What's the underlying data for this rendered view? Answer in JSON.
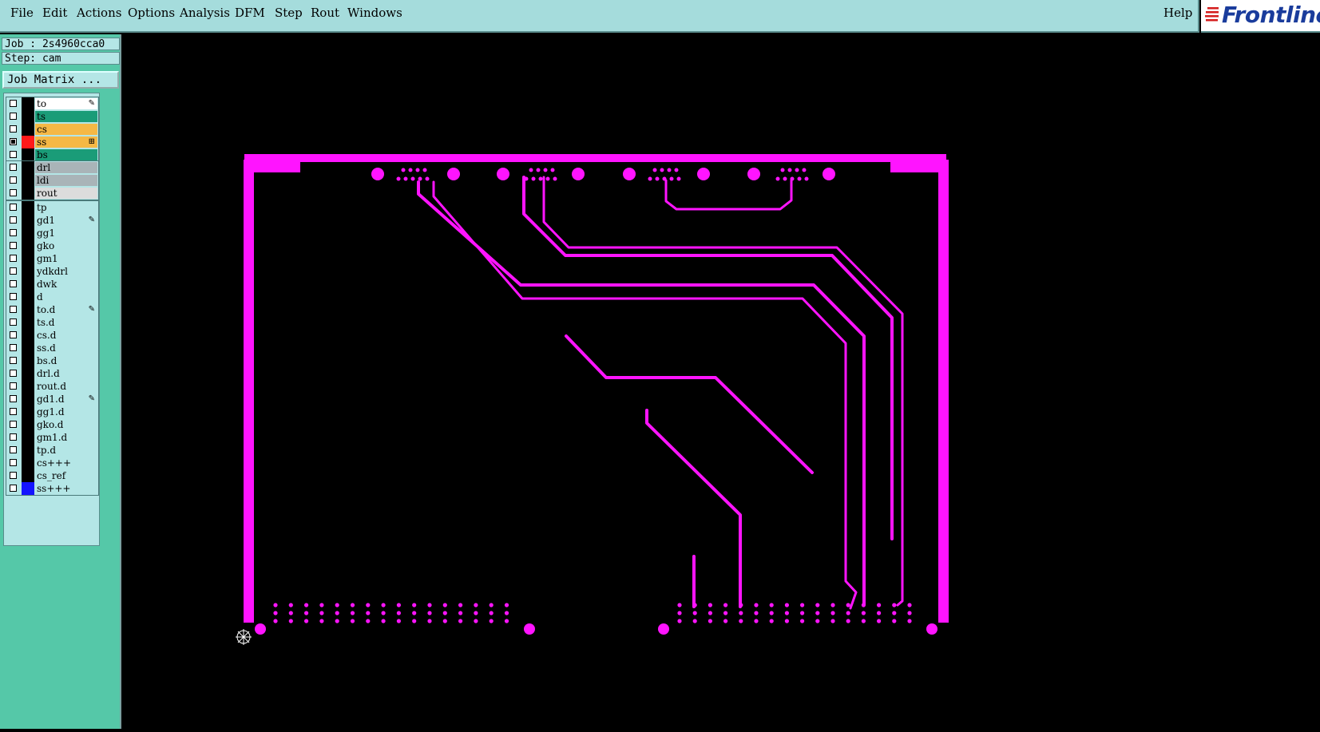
{
  "menubar": {
    "items": [
      "File",
      "Edit",
      "Actions",
      "Options",
      "Analysis",
      "DFM",
      "Step",
      "Rout",
      "Windows"
    ],
    "help": "Help"
  },
  "logo": {
    "text": "Frontline",
    "accent": "#d41c1c",
    "text_color": "#1a3c9c"
  },
  "sidebar": {
    "job_label": "Job : 2s4960cca0",
    "step_label": "Step: cam",
    "job_matrix_button": "Job Matrix ...",
    "layer_groups": [
      [
        {
          "name": "to",
          "color": "#ffffff",
          "checked": false,
          "swatch": "#000000",
          "mark": "pen"
        },
        {
          "name": "ts",
          "color": "#1a9c78",
          "checked": false,
          "swatch": "#000000",
          "mark": ""
        },
        {
          "name": "cs",
          "color": "#f5b845",
          "checked": false,
          "swatch": "#000000",
          "mark": ""
        },
        {
          "name": "ss",
          "color": "#f5b845",
          "checked": true,
          "swatch": "#ff1a1a",
          "mark": "grid"
        },
        {
          "name": "bs",
          "color": "#1a9c78",
          "checked": false,
          "swatch": "#000000",
          "mark": ""
        }
      ],
      [
        {
          "name": "drl",
          "color": "#a9b4b8",
          "checked": false,
          "swatch": "#000000",
          "mark": ""
        },
        {
          "name": "ldi",
          "color": "#a9b4b8",
          "checked": false,
          "swatch": "#000000",
          "mark": ""
        },
        {
          "name": "rout",
          "color": "#dcdcdc",
          "checked": false,
          "swatch": "#000000",
          "mark": ""
        }
      ],
      [
        {
          "name": "tp",
          "color": "#b4e6e6",
          "checked": false,
          "swatch": "#000000",
          "mark": ""
        },
        {
          "name": "gd1",
          "color": "#b4e6e6",
          "checked": false,
          "swatch": "#000000",
          "mark": "pen"
        },
        {
          "name": "gg1",
          "color": "#b4e6e6",
          "checked": false,
          "swatch": "#000000",
          "mark": ""
        },
        {
          "name": "gko",
          "color": "#b4e6e6",
          "checked": false,
          "swatch": "#000000",
          "mark": ""
        },
        {
          "name": "gm1",
          "color": "#b4e6e6",
          "checked": false,
          "swatch": "#000000",
          "mark": ""
        },
        {
          "name": "ydkdrl",
          "color": "#b4e6e6",
          "checked": false,
          "swatch": "#000000",
          "mark": ""
        },
        {
          "name": "dwk",
          "color": "#b4e6e6",
          "checked": false,
          "swatch": "#000000",
          "mark": ""
        },
        {
          "name": "d",
          "color": "#b4e6e6",
          "checked": false,
          "swatch": "#000000",
          "mark": ""
        },
        {
          "name": "to.d",
          "color": "#b4e6e6",
          "checked": false,
          "swatch": "#000000",
          "mark": "pen"
        },
        {
          "name": "ts.d",
          "color": "#b4e6e6",
          "checked": false,
          "swatch": "#000000",
          "mark": ""
        },
        {
          "name": "cs.d",
          "color": "#b4e6e6",
          "checked": false,
          "swatch": "#000000",
          "mark": ""
        },
        {
          "name": "ss.d",
          "color": "#b4e6e6",
          "checked": false,
          "swatch": "#000000",
          "mark": ""
        },
        {
          "name": "bs.d",
          "color": "#b4e6e6",
          "checked": false,
          "swatch": "#000000",
          "mark": ""
        },
        {
          "name": "drl.d",
          "color": "#b4e6e6",
          "checked": false,
          "swatch": "#000000",
          "mark": ""
        },
        {
          "name": "rout.d",
          "color": "#b4e6e6",
          "checked": false,
          "swatch": "#000000",
          "mark": ""
        },
        {
          "name": "gd1.d",
          "color": "#b4e6e6",
          "checked": false,
          "swatch": "#000000",
          "mark": "pen"
        },
        {
          "name": "gg1.d",
          "color": "#b4e6e6",
          "checked": false,
          "swatch": "#000000",
          "mark": ""
        },
        {
          "name": "gko.d",
          "color": "#b4e6e6",
          "checked": false,
          "swatch": "#000000",
          "mark": ""
        },
        {
          "name": "gm1.d",
          "color": "#b4e6e6",
          "checked": false,
          "swatch": "#000000",
          "mark": ""
        },
        {
          "name": "tp.d",
          "color": "#b4e6e6",
          "checked": false,
          "swatch": "#000000",
          "mark": ""
        },
        {
          "name": "cs+++",
          "color": "#b4e6e6",
          "checked": false,
          "swatch": "#000000",
          "mark": ""
        },
        {
          "name": "cs_ref",
          "color": "#b4e6e6",
          "checked": false,
          "swatch": "#000000",
          "mark": ""
        },
        {
          "name": "ss+++",
          "color": "#b4e6e6",
          "checked": false,
          "swatch": "#1414ff",
          "mark": ""
        }
      ]
    ]
  },
  "canvas": {
    "background": "#000000",
    "trace_color": "#ff14ff"
  }
}
